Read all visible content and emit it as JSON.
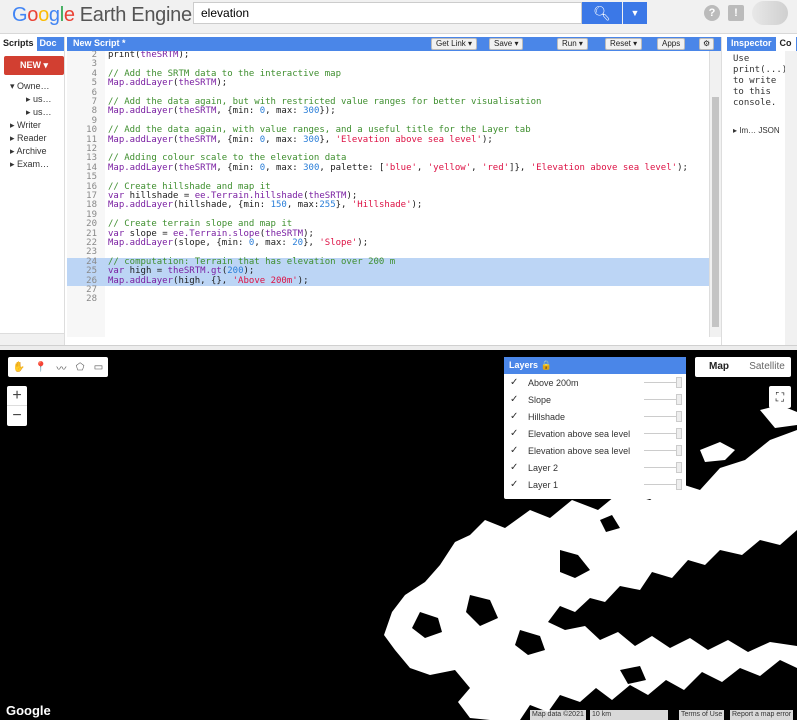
{
  "app": {
    "logo_google": "Google",
    "logo_rest": "Earth Engine"
  },
  "search": {
    "value": "elevation"
  },
  "toolbar": {
    "help": "?",
    "feedback": "!"
  },
  "left_panel": {
    "tabs": [
      "Scripts",
      "Doc"
    ],
    "new_label": "NEW",
    "tree": [
      "Owne…",
      "us…",
      "us…",
      "Writer",
      "Reader",
      "Archive",
      "Exam…"
    ]
  },
  "editor": {
    "title": "New Script *",
    "buttons": {
      "get_link": "Get Link",
      "save": "Save",
      "run": "Run",
      "reset": "Reset",
      "apps": "Apps"
    },
    "lines": [
      {
        "n": "2",
        "t": "print(theSRTM);"
      },
      {
        "n": "3",
        "t": ""
      },
      {
        "n": "4",
        "t": "// Add the SRTM data to the interactive map"
      },
      {
        "n": "5",
        "t": "Map.addLayer(theSRTM);"
      },
      {
        "n": "6",
        "t": ""
      },
      {
        "n": "7",
        "t": "// Add the data again, but with restricted value ranges for better visualisation"
      },
      {
        "n": "8",
        "t": "Map.addLayer(theSRTM, {min: 0, max: 300});"
      },
      {
        "n": "9",
        "t": ""
      },
      {
        "n": "10",
        "t": "// Add the data again, with value ranges, and a useful title for the Layer tab"
      },
      {
        "n": "11",
        "t": "Map.addLayer(theSRTM, {min: 0, max: 300}, 'Elevation above sea level');"
      },
      {
        "n": "12",
        "t": ""
      },
      {
        "n": "13",
        "t": "// Adding colour scale to the elevation data"
      },
      {
        "n": "14",
        "t": "Map.addLayer(theSRTM, {min: 0, max: 300, palette: ['blue', 'yellow', 'red']}, 'Elevation above sea level');"
      },
      {
        "n": "15",
        "t": ""
      },
      {
        "n": "16",
        "t": "// Create hillshade and map it"
      },
      {
        "n": "17",
        "t": "var hillshade = ee.Terrain.hillshade(theSRTM);"
      },
      {
        "n": "18",
        "t": "Map.addLayer(hillshade, {min: 150, max:255}, 'Hillshade');"
      },
      {
        "n": "19",
        "t": ""
      },
      {
        "n": "20",
        "t": "// Create terrain slope and map it"
      },
      {
        "n": "21",
        "t": "var slope = ee.Terrain.slope(theSRTM);"
      },
      {
        "n": "22",
        "t": "Map.addLayer(slope, {min: 0, max: 20}, 'Slope');"
      },
      {
        "n": "23",
        "t": ""
      },
      {
        "n": "24",
        "t": "// computation: Terrain that has elevation over 200 m"
      },
      {
        "n": "25",
        "t": "var high = theSRTM.gt(200);"
      },
      {
        "n": "26",
        "t": "Map.addLayer(high, {}, 'Above 200m');"
      },
      {
        "n": "27",
        "t": ""
      },
      {
        "n": "28",
        "t": ""
      }
    ]
  },
  "right_panel": {
    "tabs": [
      "Inspector",
      "Co"
    ],
    "console_text": "Use print(...) to write to this console.",
    "inspector_item": "▸ Im… JSON"
  },
  "map": {
    "tools": [
      "✋",
      "📍",
      "〰",
      "⬠",
      "▭"
    ],
    "zoom_in": "+",
    "zoom_out": "−",
    "fullscreen": "⛶",
    "map_type": [
      "Map",
      "Satellite"
    ],
    "layers_title": "Layers",
    "layers": [
      "Above 200m",
      "Slope",
      "Hillshade",
      "Elevation above sea level",
      "Elevation above sea level",
      "Layer 2",
      "Layer 1"
    ],
    "google_mark": "Google",
    "attribution": {
      "map_data": "Map data ©2021",
      "scale": "10 km",
      "terms": "Terms of Use",
      "report": "Report a map error"
    }
  }
}
